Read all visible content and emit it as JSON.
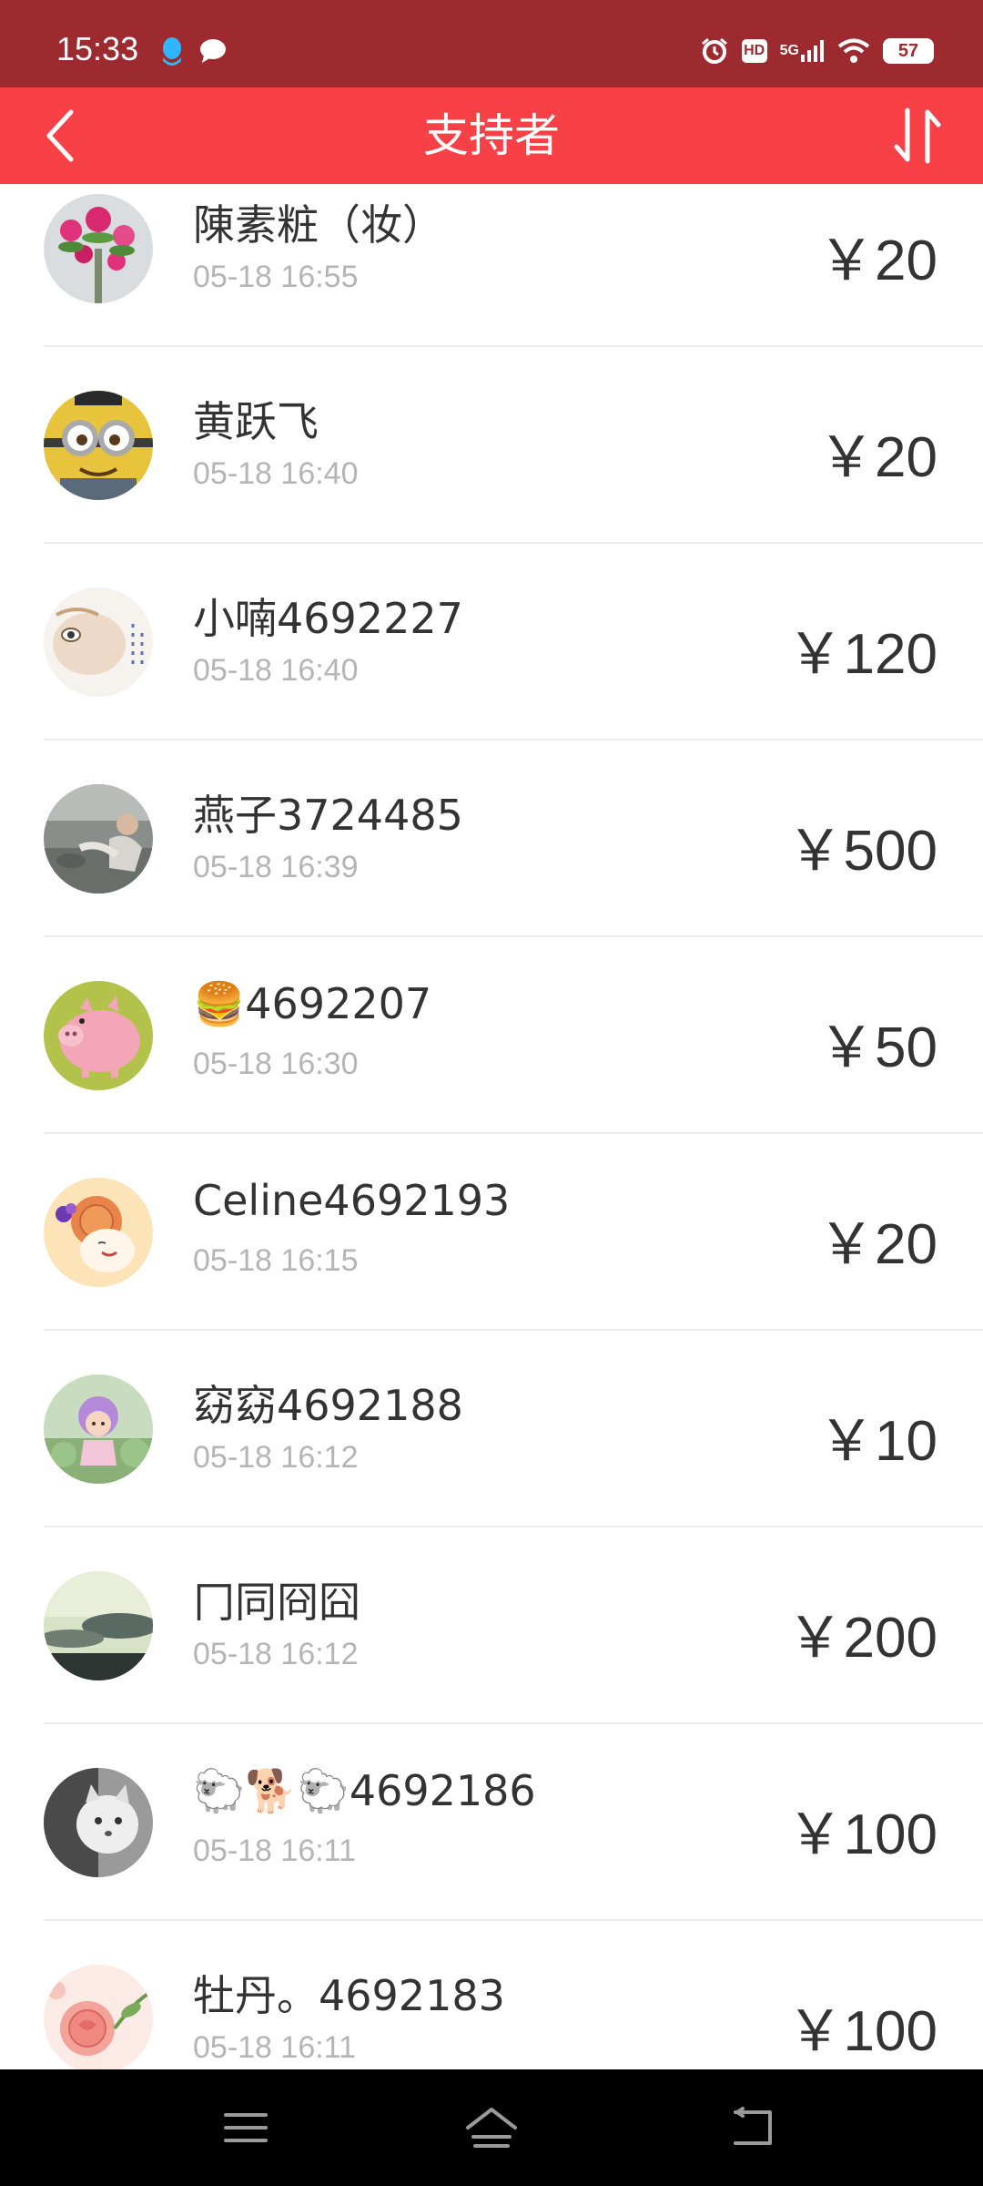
{
  "status_bar": {
    "time": "15:33",
    "left_icons": [
      "qq-icon",
      "chat-bubble-icon"
    ],
    "right_icons": [
      "alarm-icon",
      "hd-icon",
      "signal-5g-icon",
      "wifi-icon"
    ],
    "hd_label": "HD",
    "network_label": "5G",
    "battery": "57",
    "background_color": "#9c2a2e"
  },
  "header": {
    "title": "支持者",
    "back_icon": "chevron-left-icon",
    "sort_icon": "sort-icon",
    "background_color": "#f74146"
  },
  "supporters": [
    {
      "name": "陳素粧（妆）",
      "time": "05-18 16:55",
      "amount": "￥20",
      "avatar": "flowers"
    },
    {
      "name": "黄跃飞",
      "time": "05-18 16:40",
      "amount": "￥20",
      "avatar": "minion"
    },
    {
      "name": "小喃4692227",
      "time": "05-18 16:40",
      "amount": "￥120",
      "avatar": "cat-painting"
    },
    {
      "name": "燕子3724485",
      "time": "05-18 16:39",
      "amount": "￥500",
      "avatar": "photo-person"
    },
    {
      "name": "🍔4692207",
      "time": "05-18 16:30",
      "amount": "￥50",
      "avatar": "pig"
    },
    {
      "name": "Celine4692193",
      "time": "05-18 16:15",
      "amount": "￥20",
      "avatar": "cartoon-girl"
    },
    {
      "name": "窈窈4692188",
      "time": "05-18 16:12",
      "amount": "￥10",
      "avatar": "child-garden"
    },
    {
      "name": "冂同冏囧",
      "time": "05-18 16:12",
      "amount": "￥200",
      "avatar": "sky"
    },
    {
      "name": "🐑🐕🐑4692186",
      "time": "05-18 16:11",
      "amount": "￥100",
      "avatar": "bw-cat"
    },
    {
      "name": "牡丹。4692183",
      "time": "05-18 16:11",
      "amount": "￥100",
      "avatar": "rose"
    }
  ],
  "nav_bar": {
    "buttons": [
      "menu-icon",
      "home-icon",
      "back-icon"
    ]
  }
}
